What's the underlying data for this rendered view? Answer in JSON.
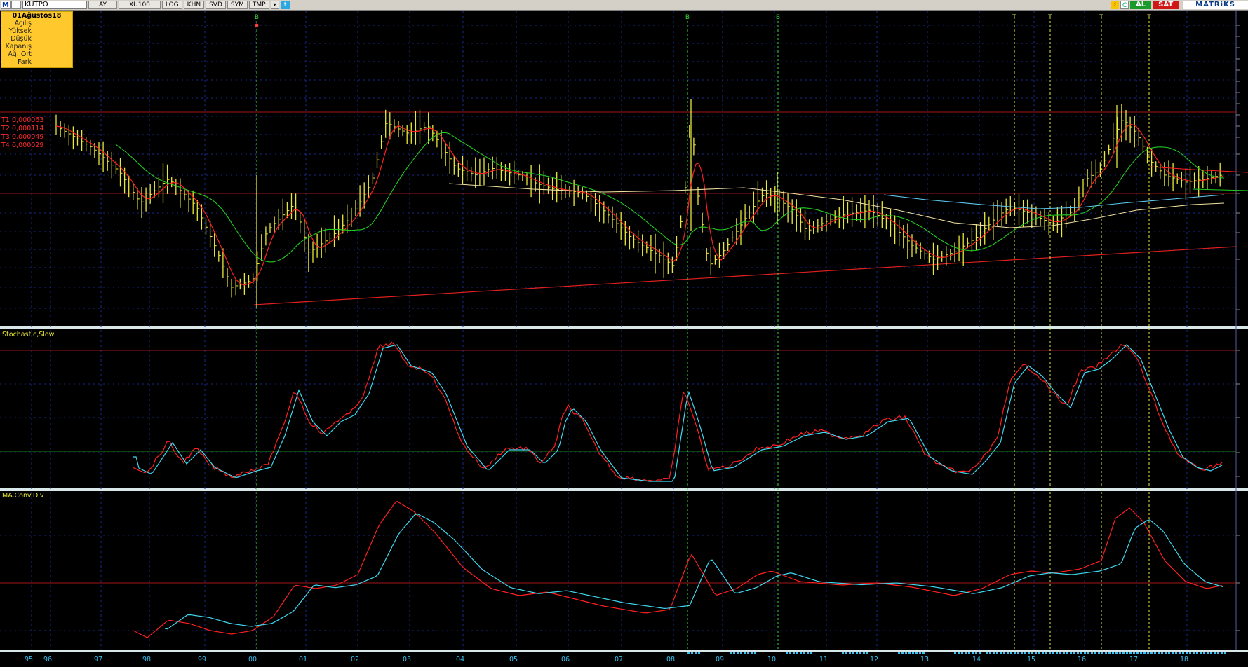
{
  "toolbar": {
    "logo": "M",
    "symbol": "KUTPO",
    "period": "AY",
    "index": "XU100",
    "buttons": [
      "LOG",
      "KHN",
      "SVD",
      "SYM",
      "TMP"
    ],
    "dropdown": "▾",
    "c_label": "C",
    "al_label": "AL",
    "sat_label": "SAT",
    "brand": "MATRiKS"
  },
  "data_box": {
    "date": "01Ağustos18",
    "rows": [
      "Açılış",
      "Yüksek",
      "Düşük",
      "Kapanış",
      "Ağ. Ort",
      "Fark"
    ]
  },
  "trendlines": [
    "T1:0,000063",
    "T2:0,000114",
    "T3:0,000049",
    "T4:0,000029"
  ],
  "signals": [
    {
      "label": "B",
      "color": "#33dd33"
    },
    {
      "label": "B",
      "color": "#33dd33"
    },
    {
      "label": "B",
      "color": "#33dd33"
    },
    {
      "label": "T",
      "color": "#e8e83a"
    },
    {
      "label": "T",
      "color": "#e8e83a"
    },
    {
      "label": "T",
      "color": "#e8e83a"
    },
    {
      "label": "T",
      "color": "#e8e83a"
    }
  ],
  "panels": {
    "stochastic": "Stochastic,Slow",
    "macd": "MA.Conv.Div"
  },
  "years": [
    "95",
    "96",
    "97",
    "98",
    "99",
    "00",
    "01",
    "02",
    "03",
    "04",
    "05",
    "06",
    "07",
    "08",
    "09",
    "10",
    "11",
    "12",
    "13",
    "14",
    "15",
    "16",
    "17",
    "18"
  ],
  "colors": {
    "background": "#000000",
    "bars": "#e8e83a",
    "ma_fast": "#ff2020",
    "ma_mid": "#22cc22",
    "ma_slow": "#f0e0a0",
    "ma_blue": "#60c8f0",
    "stoch_k": "#ff2020",
    "stoch_d": "#40d8f0",
    "grid": "#1a2a8a",
    "axis_text": "#37c0f0"
  }
}
